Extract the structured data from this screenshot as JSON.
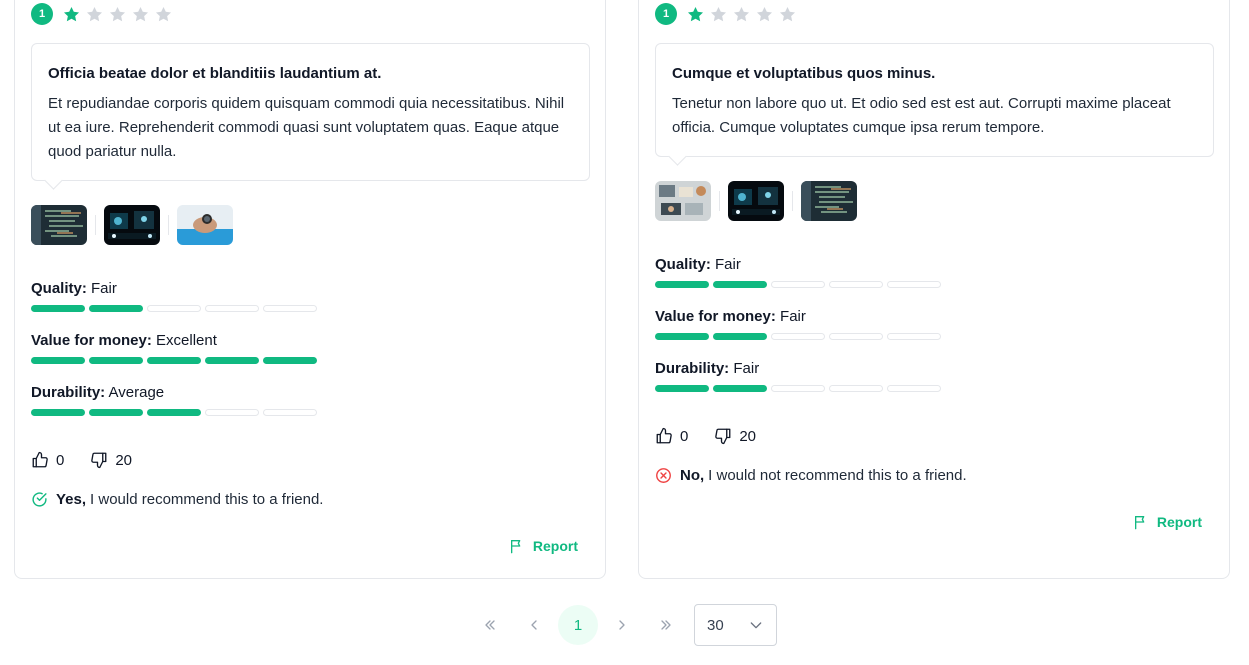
{
  "colors": {
    "accent": "#10b981",
    "star_off": "#d1d5db",
    "danger": "#ef4444"
  },
  "reviews": [
    {
      "rating": 1,
      "max_rating": 5,
      "rating_badge": "1",
      "title": "Officia beatae dolor et blanditiis laudantium at.",
      "body": "Et repudiandae corporis quidem quisquam commodi quia necessitatibus. Nihil ut ea iure. Reprehenderit commodi quasi sunt voluptatem quas. Eaque atque quod pariatur nulla.",
      "images": [
        "code-screen-photo",
        "dark-monitors-photo",
        "hand-watch-photo"
      ],
      "metrics": [
        {
          "label": "Quality:",
          "value": "Fair",
          "level": 2,
          "max": 5
        },
        {
          "label": "Value for money:",
          "value": "Excellent",
          "level": 5,
          "max": 5
        },
        {
          "label": "Durability:",
          "value": "Average",
          "level": 3,
          "max": 5
        }
      ],
      "upvotes": "0",
      "downvotes": "20",
      "recommend": {
        "positive": true,
        "answer": "Yes,",
        "text": "I would recommend this to a friend."
      },
      "report_label": "Report"
    },
    {
      "rating": 1,
      "max_rating": 5,
      "rating_badge": "1",
      "title": "Cumque et voluptatibus quos minus.",
      "body": "Tenetur non labore quo ut. Et odio sed est est aut. Corrupti maxime placeat officia. Cumque voluptates cumque ipsa rerum tempore.",
      "images": [
        "desk-topview-photo",
        "dark-monitors-photo",
        "code-screen-photo"
      ],
      "metrics": [
        {
          "label": "Quality:",
          "value": "Fair",
          "level": 2,
          "max": 5
        },
        {
          "label": "Value for money:",
          "value": "Fair",
          "level": 2,
          "max": 5
        },
        {
          "label": "Durability:",
          "value": "Fair",
          "level": 2,
          "max": 5
        }
      ],
      "upvotes": "0",
      "downvotes": "20",
      "recommend": {
        "positive": false,
        "answer": "No,",
        "text": "I would not recommend this to a friend."
      },
      "report_label": "Report"
    }
  ],
  "pagination": {
    "current_page": "1",
    "page_size": "30",
    "icons": [
      "first-page-icon",
      "prev-page-icon",
      "next-page-icon",
      "last-page-icon",
      "chevron-down-icon"
    ]
  }
}
